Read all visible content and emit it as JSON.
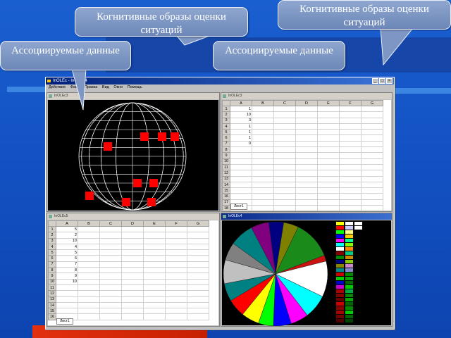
{
  "callouts": [
    {
      "text": "Ассоциируемые данные"
    },
    {
      "text": "Когнитивные образы оценки ситуаций"
    },
    {
      "text": "Ассоциируемые данные"
    },
    {
      "text": "Когнитивные образы оценки ситуаций"
    }
  ],
  "app": {
    "title": "InOLEc - InOLEc4",
    "menu": [
      "Действие",
      "Файл",
      "Правка",
      "Вид",
      "Окно",
      "Помощь"
    ]
  },
  "windows": {
    "sphere": {
      "title": "InOLEc3"
    },
    "sheet1": {
      "title": "InOLEc3",
      "columns": [
        "A",
        "B",
        "C",
        "D",
        "E",
        "F",
        "G"
      ],
      "values": [
        "1",
        "10",
        "3",
        "1",
        "1",
        "1",
        "0",
        "",
        "",
        "",
        "",
        "",
        "",
        "",
        "",
        "",
        "",
        ""
      ],
      "tab": "Лист1"
    },
    "sheet2": {
      "title": "InOLEc5",
      "columns": [
        "A",
        "B",
        "C",
        "D",
        "E",
        "F",
        "G"
      ],
      "values": [
        "5",
        "2",
        "10",
        "4",
        "5",
        "6",
        "7",
        "8",
        "9",
        "10",
        "",
        "",
        "",
        "",
        "",
        ""
      ],
      "tab": "Лист1"
    },
    "pie": {
      "title": "InOLEc4",
      "slice_colors": [
        "#1a8a1a",
        "#cc1111",
        "#ffffff",
        "#00ffff",
        "#ff00ff",
        "#0000ff",
        "#00ff00",
        "#ffff00",
        "#ff0000",
        "#008080",
        "#c0c0c0",
        "#808080",
        "#008080",
        "#800080",
        "#000080",
        "#808000"
      ],
      "slice_values": [
        13,
        2,
        12,
        8,
        6,
        6,
        5,
        6,
        6,
        6,
        8,
        6,
        8,
        6,
        5,
        5
      ]
    }
  },
  "sphere_markers": 9
}
